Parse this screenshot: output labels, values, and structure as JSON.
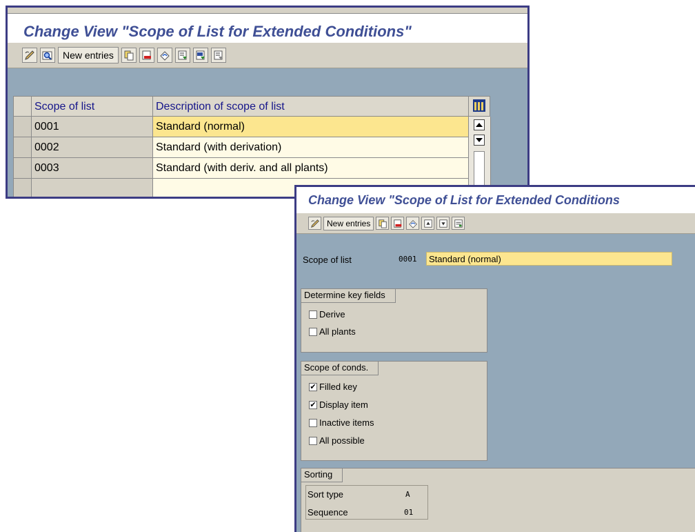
{
  "window1": {
    "title": "Change View \"Scope of List for Extended Conditions\"",
    "toolbar": {
      "new_entries_label": "New entries"
    },
    "table": {
      "columns": [
        "Scope of list",
        "Description of scope of list"
      ],
      "rows": [
        {
          "scope": "0001",
          "description": "Standard (normal)"
        },
        {
          "scope": "0002",
          "description": "Standard (with derivation)"
        },
        {
          "scope": "0003",
          "description": "Standard (with deriv. and all plants)"
        }
      ]
    }
  },
  "window2": {
    "title": "Change View \"Scope of List for Extended Conditions",
    "toolbar": {
      "new_entries_label": "New entries"
    },
    "scope_label": "Scope of list",
    "scope_code": "0001",
    "scope_desc": "Standard (normal)",
    "group_key_fields": {
      "title": "Determine key fields",
      "items": [
        {
          "label": "Derive",
          "checked": false
        },
        {
          "label": "All plants",
          "checked": false
        }
      ]
    },
    "group_scope": {
      "title": "Scope of conds.",
      "items": [
        {
          "label": "Filled key",
          "checked": true
        },
        {
          "label": "Display item",
          "checked": true
        },
        {
          "label": "Inactive items",
          "checked": false
        },
        {
          "label": "All possible",
          "checked": false
        }
      ]
    },
    "sorting": {
      "title": "Sorting",
      "sort_type_label": "Sort type",
      "sort_type_value": "A",
      "sequence_label": "Sequence",
      "sequence_value": "01"
    }
  },
  "colors": {
    "title_text": "#3f4f95",
    "frame": "#3c3c84",
    "panel": "#d5d1c5",
    "work_area": "#93a8b9",
    "highlight": "#fce68f"
  }
}
